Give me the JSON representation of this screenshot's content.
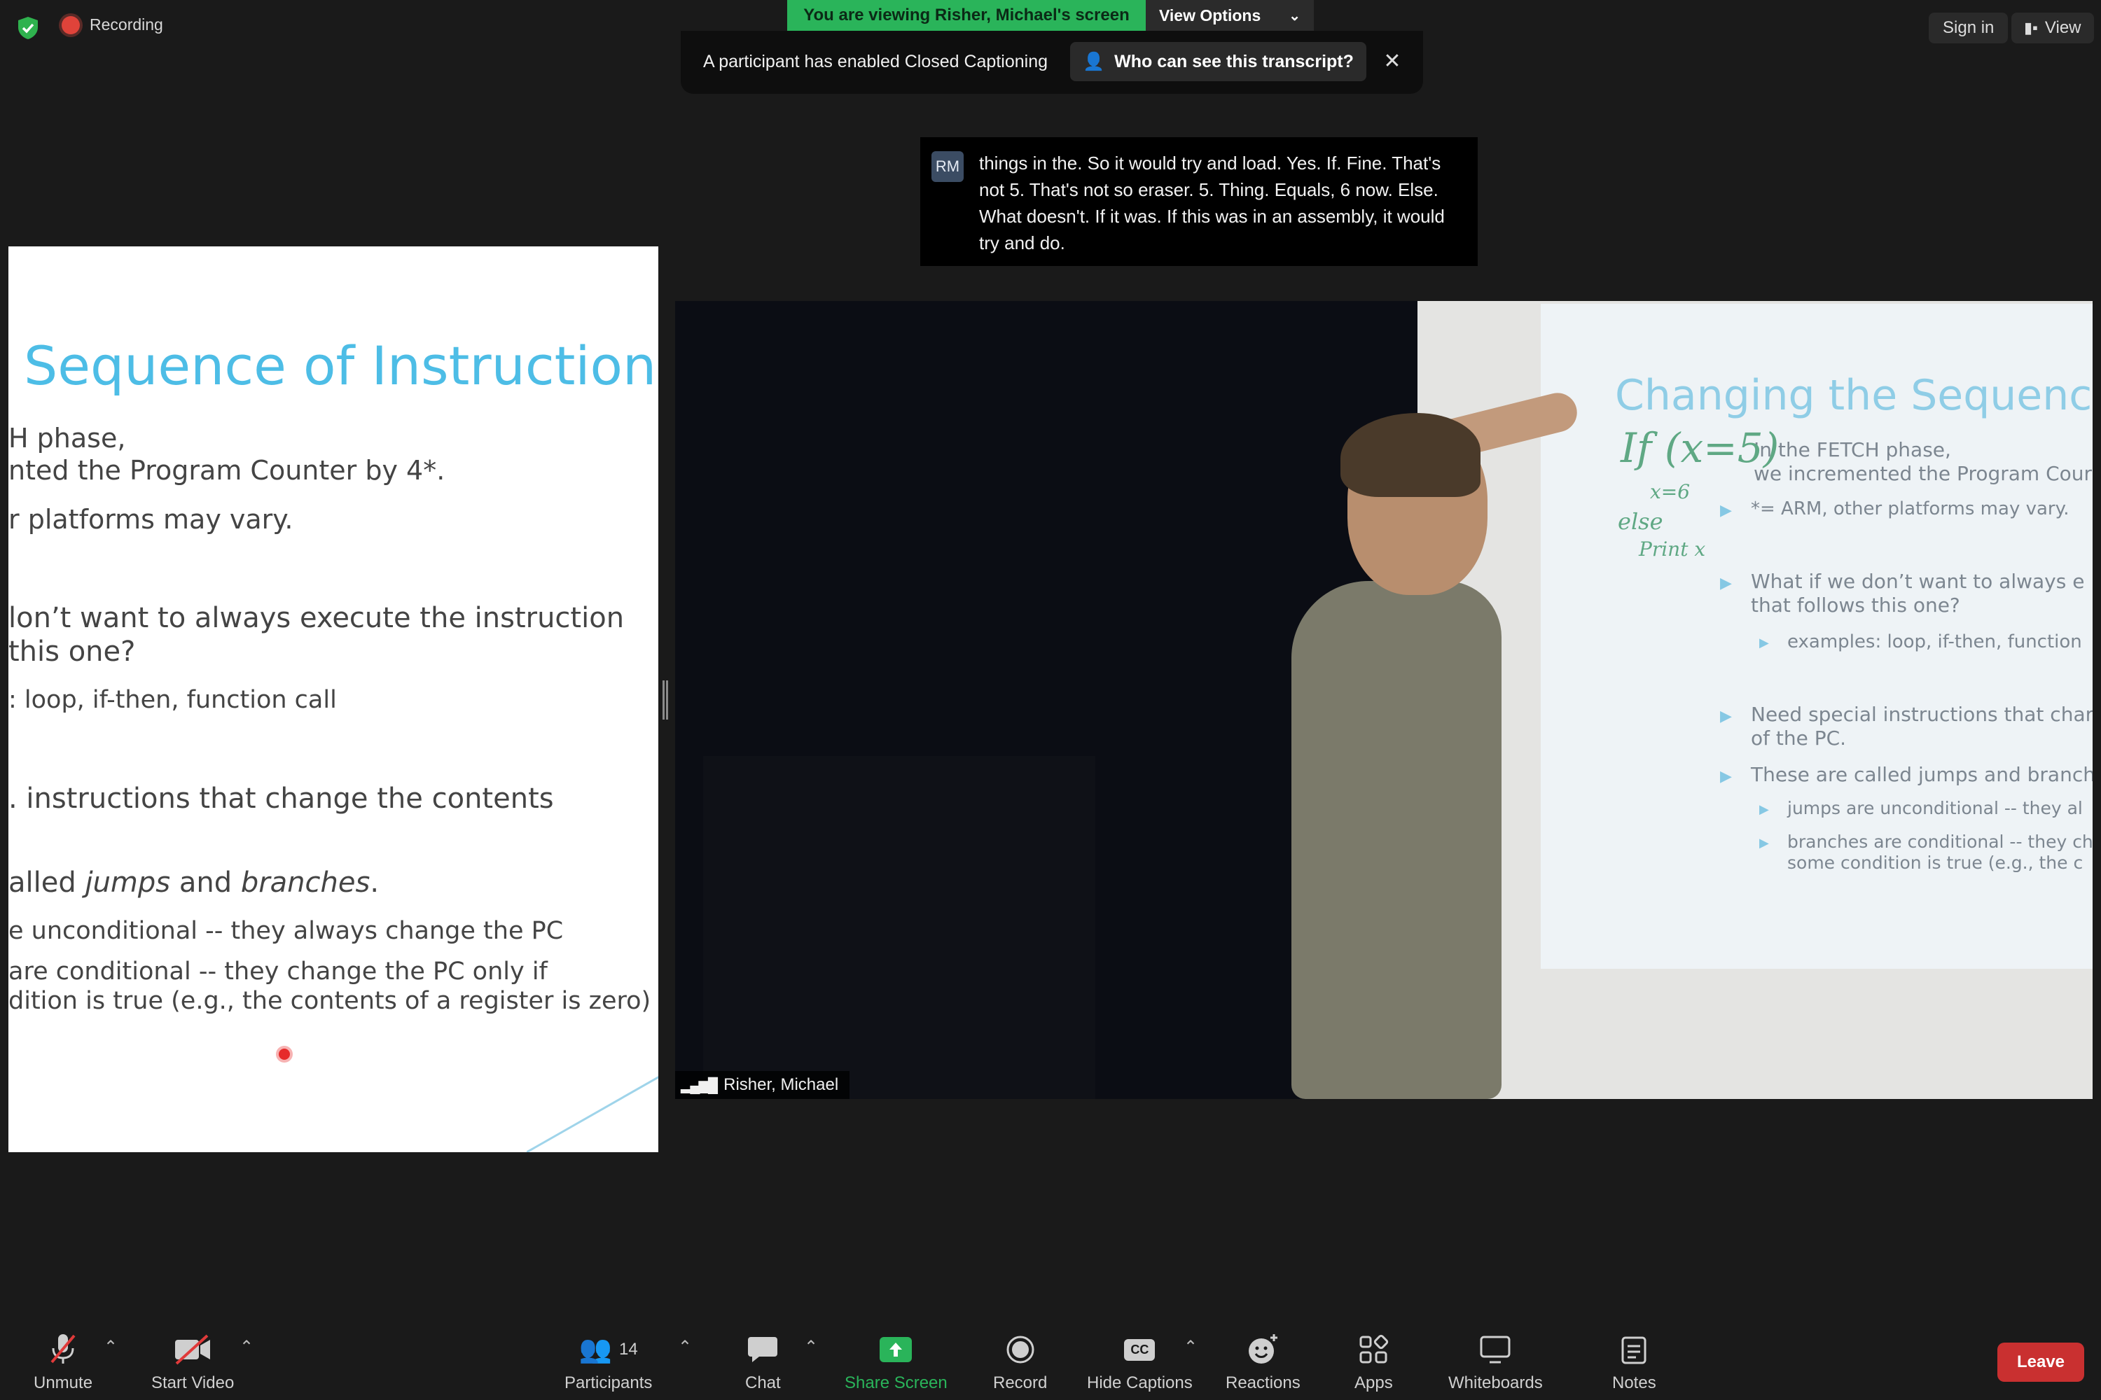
{
  "top": {
    "recording_label": "Recording",
    "viewing_banner": "You are viewing Risher, Michael's screen",
    "view_options": "View Options",
    "sign_in": "Sign in",
    "view": "View"
  },
  "cc_banner": {
    "message": "A participant has enabled Closed Captioning",
    "who_can_see": "Who can see this transcript?",
    "close": "✕"
  },
  "transcript": {
    "avatar": "RM",
    "text": "things in the. So it would try and load. Yes. If. Fine. That's not 5. That's not so eraser. 5. Thing. Equals, 6 now. Else. What doesn't. If it was. If this was in an assembly, it would try and do."
  },
  "slide": {
    "title": "Sequence of Instruction",
    "lines": [
      "H phase,",
      "nted the Program Counter by 4*.",
      "r platforms may vary.",
      "lon’t want to always execute the instruction",
      "this one?",
      ": loop, if-then, function call",
      ". instructions that change the contents",
      "alled ",
      "jumps",
      " and ",
      "branches",
      ".",
      "e unconditional -- they always change the PC",
      "are conditional -- they change the PC only if",
      "dition is true (e.g., the contents of a register is zero)"
    ]
  },
  "video": {
    "participant_name": "Risher, Michael",
    "projection_title": "Changing the Sequence",
    "projection_lines": [
      "In the FETCH phase,",
      "we incremented the Program Cour",
      "*= ARM, other platforms may vary.",
      "What if we don’t want to always e",
      "that follows this one?",
      "examples: loop, if-then, function",
      "Need special instructions that char",
      "of the PC.",
      "These are called jumps and branch",
      "jumps are unconditional -- they al",
      "branches are conditional -- they ch",
      "some condition is true (e.g., the c"
    ],
    "handwriting": [
      "If (x=5)",
      "x=6",
      "else",
      "Print x"
    ]
  },
  "toolbar": {
    "unmute": "Unmute",
    "start_video": "Start Video",
    "participants": "Participants",
    "participant_count": "14",
    "chat": "Chat",
    "share_screen": "Share Screen",
    "record": "Record",
    "hide_captions": "Hide Captions",
    "reactions": "Reactions",
    "apps": "Apps",
    "whiteboards": "Whiteboards",
    "notes": "Notes",
    "leave": "Leave"
  },
  "colors": {
    "background": "#1a1a1a",
    "share_green": "#2ab45a",
    "leave_red": "#c93030",
    "slide_title_blue": "#4dbde6",
    "security_green": "#2fb24e"
  }
}
